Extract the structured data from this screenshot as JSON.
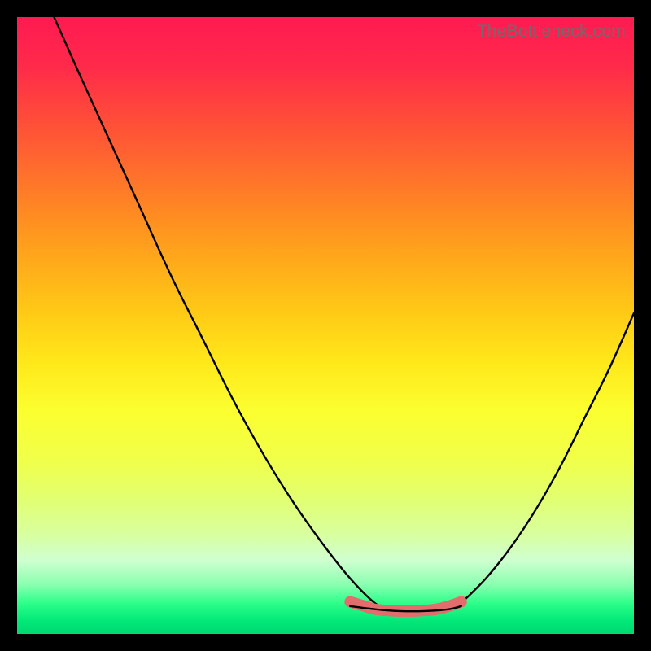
{
  "attribution": {
    "text": "TheBottleneck.com"
  },
  "colors": {
    "frame_border": "#000000",
    "curve_stroke": "#000000",
    "marker_stroke": "#e36d6d",
    "gradient_top": "#ff1a52",
    "gradient_mid": "#ffe81a",
    "gradient_bottom": "#00d870"
  },
  "chart_data": {
    "type": "line",
    "title": "",
    "xlabel": "",
    "ylabel": "",
    "xlim": [
      0,
      100
    ],
    "ylim": [
      0,
      100
    ],
    "series": [
      {
        "name": "left-curve",
        "x": [
          6,
          10,
          15,
          20,
          25,
          30,
          35,
          40,
          45,
          50,
          54,
          58,
          61.5
        ],
        "y": [
          100,
          91,
          80,
          69,
          58,
          48,
          38,
          29,
          21,
          14,
          9,
          5,
          3
        ]
      },
      {
        "name": "floor-segment",
        "x": [
          54,
          58,
          62,
          66,
          70,
          72
        ],
        "y": [
          4.5,
          4,
          3.7,
          3.7,
          4,
          4.5
        ]
      },
      {
        "name": "right-curve",
        "x": [
          72,
          76,
          80,
          84,
          88,
          92,
          96,
          100
        ],
        "y": [
          5,
          9,
          14,
          20,
          27,
          35,
          43,
          52
        ]
      },
      {
        "name": "highlight-marker",
        "x": [
          54,
          56,
          58,
          60,
          62,
          64,
          66,
          68,
          70,
          72
        ],
        "y": [
          5.2,
          4.6,
          4,
          3.8,
          3.7,
          3.7,
          3.8,
          4,
          4.5,
          5.2
        ]
      }
    ]
  }
}
